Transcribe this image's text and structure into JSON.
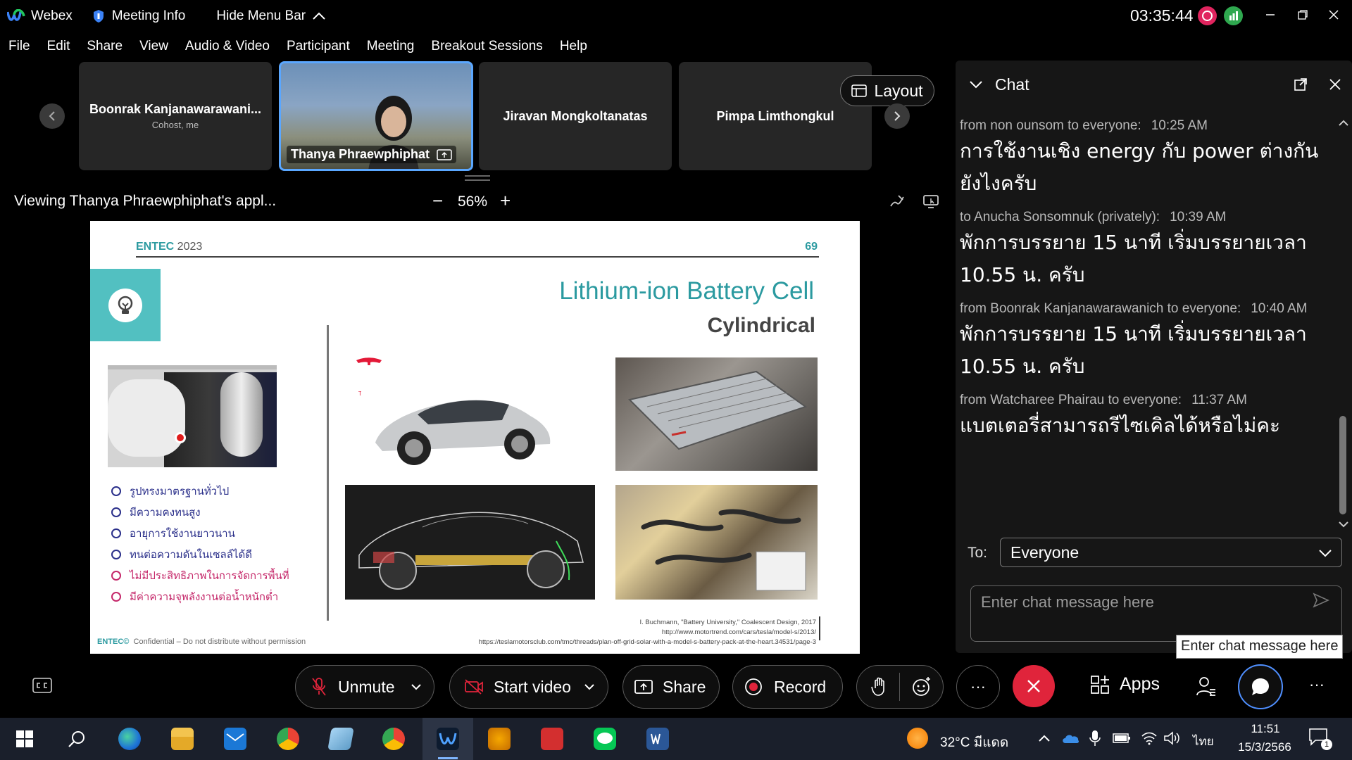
{
  "titlebar": {
    "app_name": "Webex",
    "meeting_info": "Meeting Info",
    "hide_menu": "Hide Menu Bar",
    "clock": "03:35:44"
  },
  "menubar": {
    "items": [
      "File",
      "Edit",
      "Share",
      "View",
      "Audio & Video",
      "Participant",
      "Meeting",
      "Breakout Sessions",
      "Help"
    ]
  },
  "participants": [
    {
      "name": "Boonrak Kanjanawarawani...",
      "sub": "Cohost, me"
    },
    {
      "name": "Thanya Phraewphiphat"
    },
    {
      "name": "Jiravan Mongkoltanatas"
    },
    {
      "name": "Pimpa Limthongkul"
    }
  ],
  "layout_button": "Layout",
  "share_view": {
    "label": "Viewing Thanya Phraewphiphat's appl...",
    "zoom": "56%",
    "zoom_minus": "−",
    "zoom_plus": "+"
  },
  "slide": {
    "brand_a": "ENTEC",
    "brand_b": " 2023",
    "page_number": "69",
    "title": "Lithium-ion Battery Cell",
    "subtitle": "Cylindrical",
    "tesla_wordmark": "TESLA",
    "bullets": [
      {
        "text": "รูปทรงมาตรฐานทั่วไป",
        "kind": "good"
      },
      {
        "text": "มีความคงทนสูง",
        "kind": "good"
      },
      {
        "text": "อายุการใช้งานยาวนาน",
        "kind": "good"
      },
      {
        "text": "ทนต่อความดันในเซลล์ได้ดี",
        "kind": "good"
      },
      {
        "text": "ไม่มีประสิทธิภาพในการจัดการพื้นที่",
        "kind": "bad"
      },
      {
        "text": "มีค่าความจุพลังงานต่อน้ำหนักต่ำ",
        "kind": "bad"
      }
    ],
    "refs": [
      "I. Buchmann, \"Battery University,\" Coalescent Design, 2017",
      "http://www.motortrend.com/cars/tesla/model-s/2013/",
      "https://teslamotorsclub.com/tmc/threads/plan-off-grid-solar-with-a-model-s-battery-pack-at-the-heart.34531/page-3"
    ],
    "footer_brand": "ENTEC©",
    "footer_text": "Confidential – Do not distribute without permission"
  },
  "chat": {
    "title": "Chat",
    "messages": [
      {
        "meta": "from non ounsom to everyone:",
        "time": "10:25 AM",
        "text": "การใช้งานเชิง energy กับ power ต่างกันยังไงครับ"
      },
      {
        "meta": "to Anucha Sonsomnuk (privately):",
        "time": "10:39 AM",
        "text": "พักการบรรยาย 15 นาที เริ่มบรรยายเวลา 10.55 น. ครับ"
      },
      {
        "meta": "from Boonrak Kanjanawarawanich to everyone:",
        "time": "10:40 AM",
        "text": "พักการบรรยาย 15 นาที เริ่มบรรยายเวลา 10.55 น. ครับ"
      },
      {
        "meta": "from Watcharee Phairau to everyone:",
        "time": "11:37 AM",
        "text": "แบตเตอรี่สามารถรีไซเคิลได้หรือไม่คะ"
      }
    ],
    "to_label": "To:",
    "to_value": "Everyone",
    "input_placeholder": "Enter chat message here",
    "tooltip": "Enter chat message here"
  },
  "controls": {
    "unmute": "Unmute",
    "start_video": "Start video",
    "share": "Share",
    "record": "Record",
    "more": "···",
    "apps": "Apps",
    "overflow": "···"
  },
  "taskbar": {
    "weather": "32°C  มีแดด",
    "language": "ไทย",
    "time": "11:51",
    "date": "15/3/2566",
    "notification_count": "1"
  },
  "colors": {
    "accent_teal": "#2b9aa0",
    "end_call_red": "#e0243b",
    "active_tile_border": "#5aa7ff",
    "record_red": "#e0245e"
  }
}
